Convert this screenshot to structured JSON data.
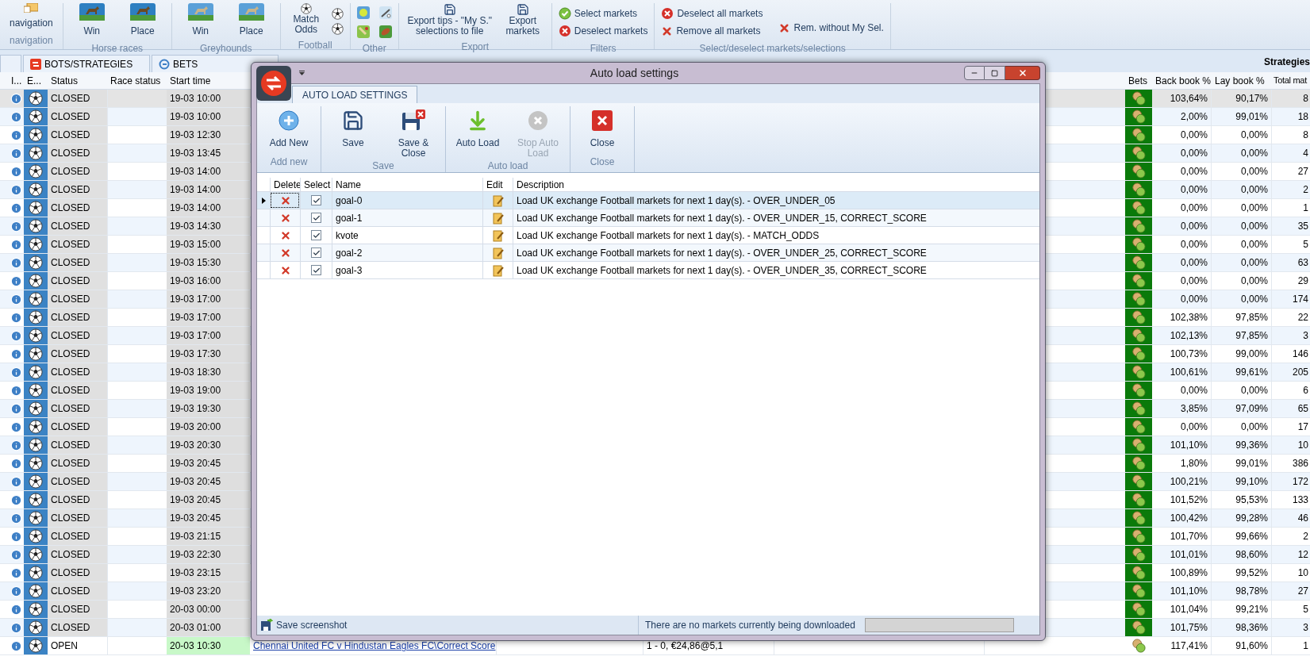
{
  "ribbon": {
    "groups": [
      {
        "kind": "nav",
        "label": "navigation",
        "items": [
          "navigation"
        ]
      },
      {
        "kind": "races",
        "label": "Horse races",
        "items": [
          "Win",
          "Place"
        ]
      },
      {
        "kind": "dogs",
        "label": "Greyhounds",
        "items": [
          "Win",
          "Place"
        ]
      },
      {
        "kind": "football",
        "label": "Football",
        "items": [
          "Match Odds"
        ]
      },
      {
        "kind": "other",
        "label": "Other"
      },
      {
        "kind": "export",
        "label": "Export",
        "items": [
          "Export tips - \"My S.\" selections to file",
          "Export markets"
        ]
      },
      {
        "kind": "filters",
        "label": "Filters",
        "items": [
          "Select markets",
          "Deselect markets"
        ]
      },
      {
        "kind": "select",
        "label": "Select/deselect markets/selections",
        "items": [
          "Deselect all markets",
          "Remove all markets",
          "Rem. without My Sel."
        ]
      }
    ]
  },
  "tabs": [
    {
      "label": "BOTS/STRATEGIES",
      "selected": false
    },
    {
      "label": "BETS",
      "selected": false
    }
  ],
  "strategies_label": "Strategies",
  "table": {
    "columns": [
      "I...",
      "E...",
      "Status",
      "Race status",
      "Start time",
      "Bets",
      "Back book %",
      "Lay book %",
      "Total mat"
    ],
    "rows": [
      {
        "kind": "closed",
        "selected": true,
        "status": "CLOSED",
        "start": "19-03 10:00",
        "back": "103,64%",
        "lay": "90,17%",
        "total": "8"
      },
      {
        "kind": "closed",
        "selected": false,
        "status": "CLOSED",
        "start": "19-03 10:00",
        "back": "2,00%",
        "lay": "99,01%",
        "total": "18"
      },
      {
        "kind": "closed",
        "selected": false,
        "status": "CLOSED",
        "start": "19-03 12:30",
        "back": "0,00%",
        "lay": "0,00%",
        "total": "8"
      },
      {
        "kind": "closed",
        "selected": false,
        "status": "CLOSED",
        "start": "19-03 13:45",
        "back": "0,00%",
        "lay": "0,00%",
        "total": "4"
      },
      {
        "kind": "closed",
        "selected": false,
        "status": "CLOSED",
        "start": "19-03 14:00",
        "back": "0,00%",
        "lay": "0,00%",
        "total": "27"
      },
      {
        "kind": "closed",
        "selected": false,
        "status": "CLOSED",
        "start": "19-03 14:00",
        "back": "0,00%",
        "lay": "0,00%",
        "total": "2"
      },
      {
        "kind": "closed",
        "selected": false,
        "status": "CLOSED",
        "start": "19-03 14:00",
        "back": "0,00%",
        "lay": "0,00%",
        "total": "1"
      },
      {
        "kind": "closed",
        "selected": false,
        "status": "CLOSED",
        "start": "19-03 14:30",
        "back": "0,00%",
        "lay": "0,00%",
        "total": "35"
      },
      {
        "kind": "closed",
        "selected": false,
        "status": "CLOSED",
        "start": "19-03 15:00",
        "back": "0,00%",
        "lay": "0,00%",
        "total": "5"
      },
      {
        "kind": "closed",
        "selected": false,
        "status": "CLOSED",
        "start": "19-03 15:30",
        "back": "0,00%",
        "lay": "0,00%",
        "total": "63"
      },
      {
        "kind": "closed",
        "selected": false,
        "status": "CLOSED",
        "start": "19-03 16:00",
        "back": "0,00%",
        "lay": "0,00%",
        "total": "29"
      },
      {
        "kind": "closed",
        "selected": false,
        "status": "CLOSED",
        "start": "19-03 17:00",
        "back": "0,00%",
        "lay": "0,00%",
        "total": "174"
      },
      {
        "kind": "closed",
        "selected": false,
        "status": "CLOSED",
        "start": "19-03 17:00",
        "back": "102,38%",
        "lay": "97,85%",
        "total": "22"
      },
      {
        "kind": "closed",
        "selected": false,
        "status": "CLOSED",
        "start": "19-03 17:00",
        "back": "102,13%",
        "lay": "97,85%",
        "total": "3"
      },
      {
        "kind": "closed",
        "selected": false,
        "status": "CLOSED",
        "start": "19-03 17:30",
        "back": "100,73%",
        "lay": "99,00%",
        "total": "146"
      },
      {
        "kind": "closed",
        "selected": false,
        "status": "CLOSED",
        "start": "19-03 18:30",
        "back": "100,61%",
        "lay": "99,61%",
        "total": "205"
      },
      {
        "kind": "closed",
        "selected": false,
        "status": "CLOSED",
        "start": "19-03 19:00",
        "back": "0,00%",
        "lay": "0,00%",
        "total": "6"
      },
      {
        "kind": "closed",
        "selected": false,
        "status": "CLOSED",
        "start": "19-03 19:30",
        "back": "3,85%",
        "lay": "97,09%",
        "total": "65"
      },
      {
        "kind": "closed",
        "selected": false,
        "status": "CLOSED",
        "start": "19-03 20:00",
        "back": "0,00%",
        "lay": "0,00%",
        "total": "17"
      },
      {
        "kind": "closed",
        "selected": false,
        "status": "CLOSED",
        "start": "19-03 20:30",
        "back": "101,10%",
        "lay": "99,36%",
        "total": "10"
      },
      {
        "kind": "closed",
        "selected": false,
        "status": "CLOSED",
        "start": "19-03 20:45",
        "back": "1,80%",
        "lay": "99,01%",
        "total": "386"
      },
      {
        "kind": "closed",
        "selected": false,
        "status": "CLOSED",
        "start": "19-03 20:45",
        "back": "100,21%",
        "lay": "99,10%",
        "total": "172"
      },
      {
        "kind": "closed",
        "selected": false,
        "status": "CLOSED",
        "start": "19-03 20:45",
        "back": "101,52%",
        "lay": "95,53%",
        "total": "133"
      },
      {
        "kind": "closed",
        "selected": false,
        "status": "CLOSED",
        "start": "19-03 20:45",
        "back": "100,42%",
        "lay": "99,28%",
        "total": "46"
      },
      {
        "kind": "closed",
        "selected": false,
        "status": "CLOSED",
        "start": "19-03 21:15",
        "back": "101,70%",
        "lay": "99,66%",
        "total": "2"
      },
      {
        "kind": "closed",
        "selected": false,
        "status": "CLOSED",
        "start": "19-03 22:30",
        "back": "101,01%",
        "lay": "98,60%",
        "total": "12"
      },
      {
        "kind": "closed",
        "selected": false,
        "status": "CLOSED",
        "start": "19-03 23:15",
        "back": "100,89%",
        "lay": "99,52%",
        "total": "10"
      },
      {
        "kind": "closed",
        "selected": false,
        "status": "CLOSED",
        "start": "19-03 23:20",
        "back": "101,10%",
        "lay": "98,78%",
        "total": "27"
      },
      {
        "kind": "closed",
        "selected": false,
        "status": "CLOSED",
        "start": "20-03 00:00",
        "back": "101,04%",
        "lay": "99,21%",
        "total": "5"
      },
      {
        "kind": "closed",
        "selected": false,
        "status": "CLOSED",
        "start": "20-03 01:00",
        "back": "101,75%",
        "lay": "98,36%",
        "total": "3"
      },
      {
        "kind": "open",
        "selected": false,
        "status": "OPEN",
        "start": "20-03 10:30",
        "market": "Chennai United FC v Hindustan Eagles FC\\Correct Score",
        "selection": "1 - 0, €24,86@5,1",
        "back": "117,41%",
        "lay": "91,60%",
        "total": "1"
      }
    ]
  },
  "dialog": {
    "title": "Auto load settings",
    "tab": {
      "label": "AUTO LOAD SETTINGS",
      "selected": true
    },
    "groups": [
      {
        "label": "Add new",
        "buttons": [
          {
            "kind": "add",
            "label": "Add New",
            "disabled": false
          }
        ]
      },
      {
        "label": "Save",
        "buttons": [
          {
            "kind": "save",
            "label": "Save",
            "disabled": false
          },
          {
            "kind": "save-close",
            "label": "Save & Close",
            "disabled": false
          }
        ]
      },
      {
        "label": "Auto load",
        "buttons": [
          {
            "kind": "load",
            "label": "Auto Load",
            "disabled": false
          },
          {
            "kind": "stop",
            "label": "Stop Auto Load",
            "disabled": true
          }
        ]
      },
      {
        "label": "Close",
        "buttons": [
          {
            "kind": "close",
            "label": "Close",
            "disabled": false
          }
        ]
      }
    ],
    "grid": {
      "columns": [
        "Delete",
        "Select",
        "Name",
        "Edit",
        "Description"
      ],
      "rows": [
        {
          "selected": true,
          "checked": true,
          "name": "goal-0",
          "description": "Load UK exchange Football markets for next 1 day(s). - OVER_UNDER_05"
        },
        {
          "selected": false,
          "checked": true,
          "name": "goal-1",
          "description": "Load UK exchange Football markets for next 1 day(s). - OVER_UNDER_15, CORRECT_SCORE"
        },
        {
          "selected": false,
          "checked": true,
          "name": "kvote",
          "description": "Load UK exchange Football markets for next 1 day(s). - MATCH_ODDS"
        },
        {
          "selected": false,
          "checked": true,
          "name": "goal-2",
          "description": "Load UK exchange Football markets for next 1 day(s). - OVER_UNDER_25, CORRECT_SCORE"
        },
        {
          "selected": false,
          "checked": true,
          "name": "goal-3",
          "description": "Load UK exchange Football markets for next 1 day(s). - OVER_UNDER_35, CORRECT_SCORE"
        }
      ]
    },
    "status": {
      "screenshot": "Save screenshot",
      "message": "There are no markets currently being downloaded",
      "level": 0
    }
  }
}
